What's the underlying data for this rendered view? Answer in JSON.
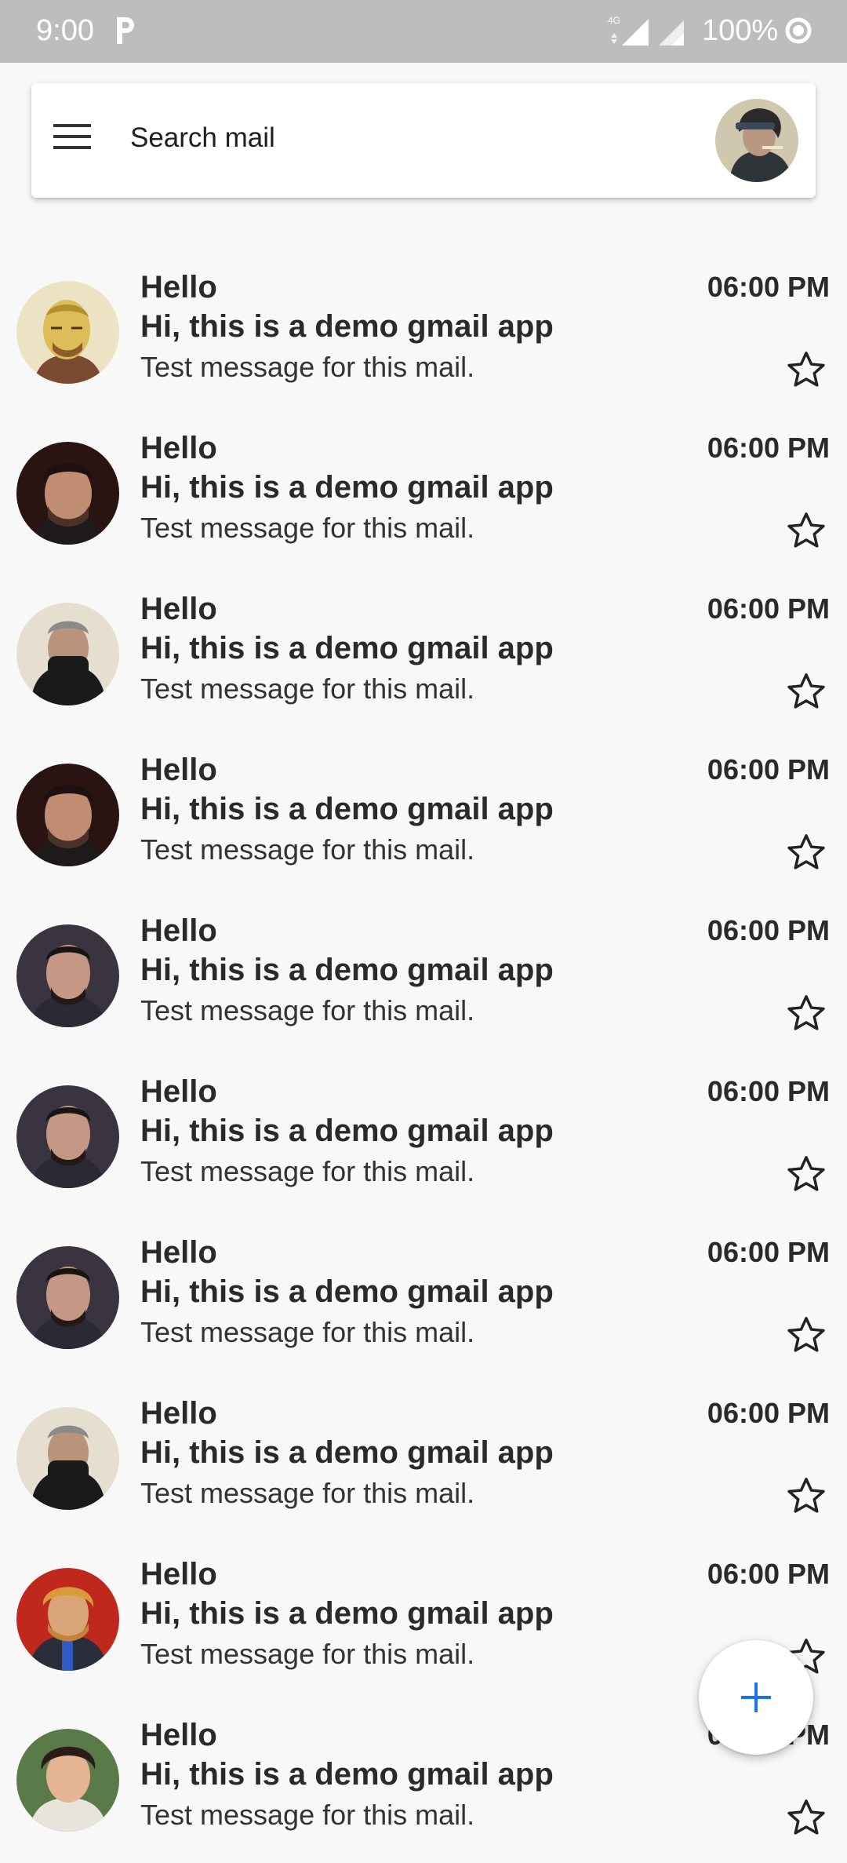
{
  "status_bar": {
    "time": "9:00",
    "battery": "100%",
    "network": "4G"
  },
  "search": {
    "placeholder": "Search mail"
  },
  "mails": [
    {
      "sender": "Hello",
      "subject": "Hi, this is a demo gmail app",
      "snippet": "Test message for this mail.",
      "time": "06:00 PM"
    },
    {
      "sender": "Hello",
      "subject": "Hi, this is a demo gmail app",
      "snippet": "Test message for this mail.",
      "time": "06:00 PM"
    },
    {
      "sender": "Hello",
      "subject": "Hi, this is a demo gmail app",
      "snippet": "Test message for this mail.",
      "time": "06:00 PM"
    },
    {
      "sender": "Hello",
      "subject": "Hi, this is a demo gmail app",
      "snippet": "Test message for this mail.",
      "time": "06:00 PM"
    },
    {
      "sender": "Hello",
      "subject": "Hi, this is a demo gmail app",
      "snippet": "Test message for this mail.",
      "time": "06:00 PM"
    },
    {
      "sender": "Hello",
      "subject": "Hi, this is a demo gmail app",
      "snippet": "Test message for this mail.",
      "time": "06:00 PM"
    },
    {
      "sender": "Hello",
      "subject": "Hi, this is a demo gmail app",
      "snippet": "Test message for this mail.",
      "time": "06:00 PM"
    },
    {
      "sender": "Hello",
      "subject": "Hi, this is a demo gmail app",
      "snippet": "Test message for this mail.",
      "time": "06:00 PM"
    },
    {
      "sender": "Hello",
      "subject": "Hi, this is a demo gmail app",
      "snippet": "Test message for this mail.",
      "time": "06:00 PM"
    },
    {
      "sender": "Hello",
      "subject": "Hi, this is a demo gmail app",
      "snippet": "Test message for this mail.",
      "time": "06:00 PM"
    }
  ],
  "icons": {
    "menu": "menu-icon",
    "star": "star-outline-icon",
    "compose": "plus-icon"
  },
  "colors": {
    "status_bar": "#bdbdbd",
    "background": "#f8f8f8",
    "fab_plus": "#1a73e8"
  }
}
